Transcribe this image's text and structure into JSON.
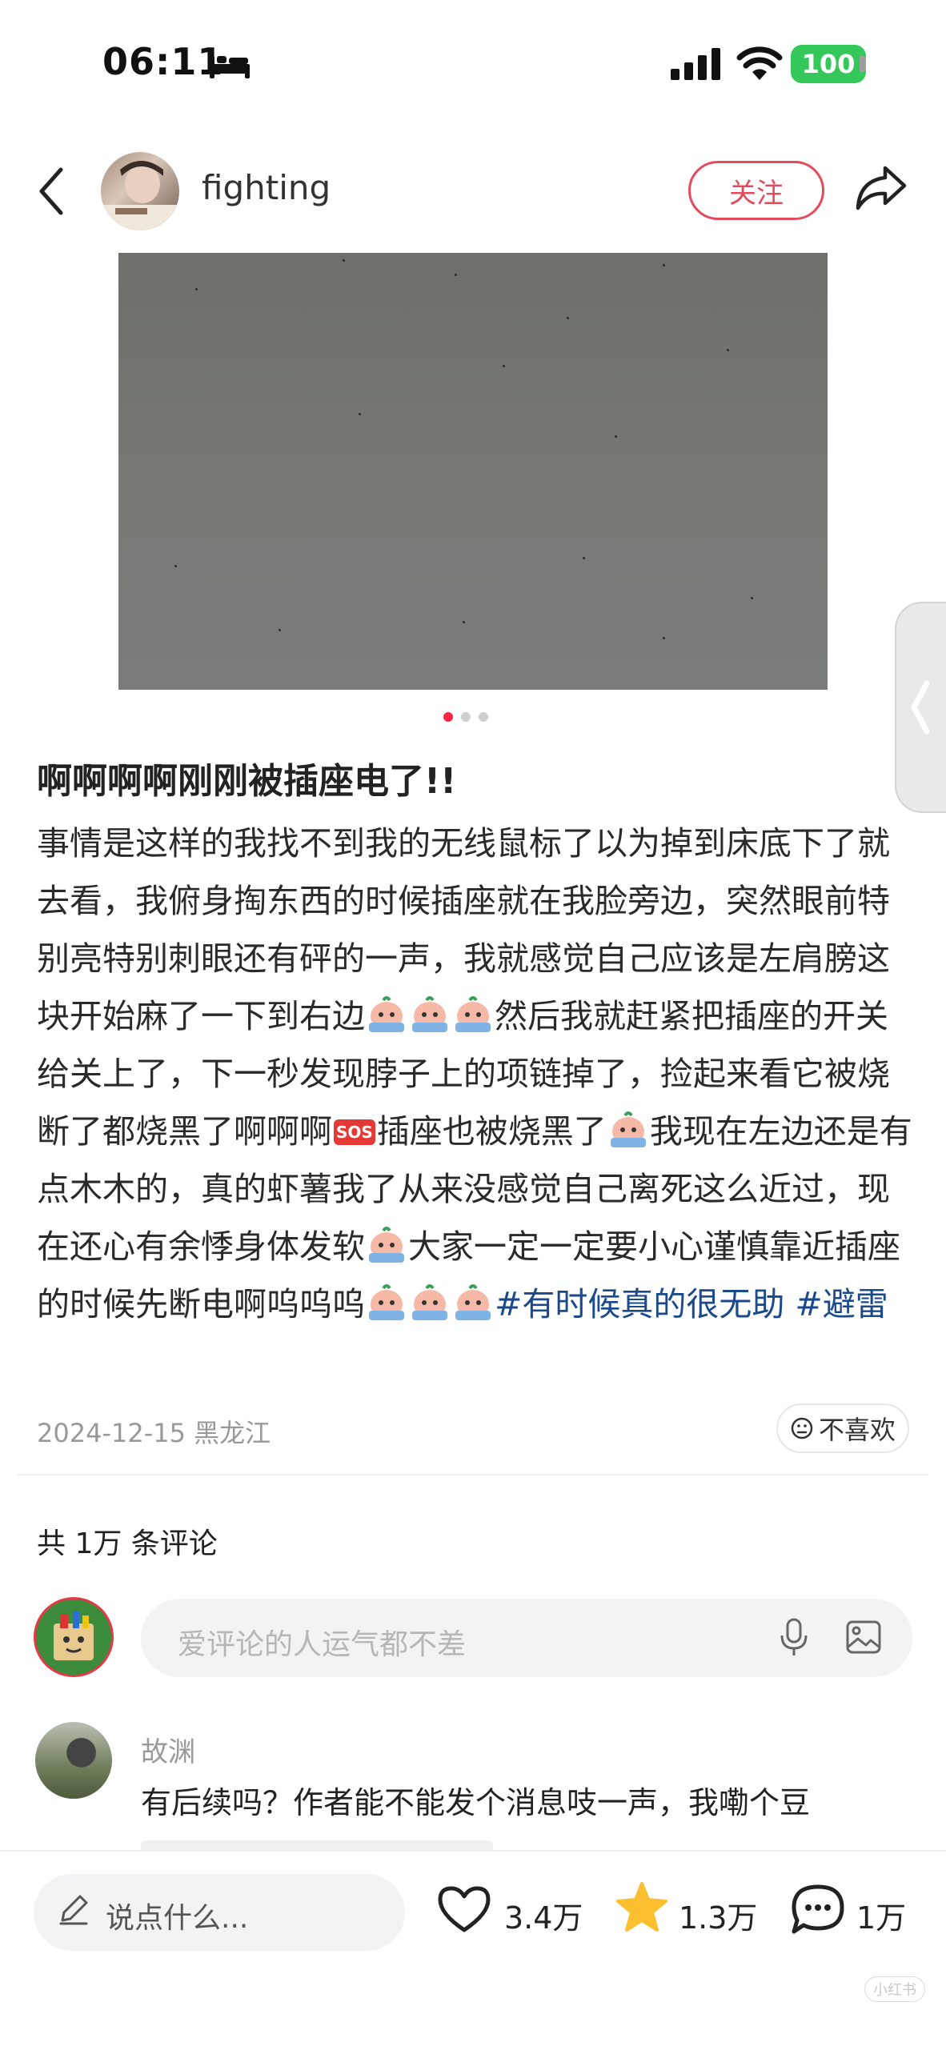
{
  "status_bar": {
    "time": "06:11",
    "battery": "100",
    "icons": [
      "bed-icon",
      "signal-icon",
      "wifi-icon",
      "battery-icon"
    ]
  },
  "header": {
    "username": "fighting",
    "follow_label": "关注",
    "icons": [
      "back-arrow-icon",
      "share-icon"
    ]
  },
  "post": {
    "image_count": 3,
    "active_image_index": 0,
    "title": "啊啊啊啊刚刚被插座电了!!",
    "body": {
      "p1": "事情是这样的我找不到我的无线鼠标了以为掉到床底下了就去看，我俯身掏东西的时候插座就在我脸旁边，突然眼前特别亮特别刺眼还有砰的一声，我就感觉自己应该是左肩膀这块开始麻了一下到右边",
      "p2": "然后我就赶紧把插座的开关给关上了，下一秒发现脖子上的项链掉了，捡起来看它被烧断了都烧黑了啊啊啊",
      "sos": "SOS",
      "p3": "插座也被烧黑了",
      "p4": "我现在左边还是有点木木的，真的虾薯我了从来没感觉自己离死这么近过，现在还心有余悸身体发软",
      "p5": "大家一定一定要小心谨慎靠近插座的时候先断电啊呜呜呜",
      "tag1": "#有时候真的很无助",
      "tag2": "#避雷"
    },
    "date": "2024-12-15",
    "location": "黑龙江",
    "dislike_label": "不喜欢"
  },
  "comments": {
    "count_label": "共 1万 条评论",
    "input_placeholder": "爱评论的人运气都不差",
    "items": [
      {
        "author": "故渊",
        "text": "有后续吗？作者能不能发个消息吱一声，我嘞个豆"
      }
    ]
  },
  "bottom_bar": {
    "say_placeholder": "说点什么...",
    "likes": "3.4万",
    "stars": "1.3万",
    "comments": "1万",
    "watermark": "小红书"
  },
  "colors": {
    "accent": "#ff2442",
    "follow": "#e24b5b",
    "tag": "#1b4a8c",
    "star": "#fbbf2f",
    "battery": "#34c759"
  }
}
